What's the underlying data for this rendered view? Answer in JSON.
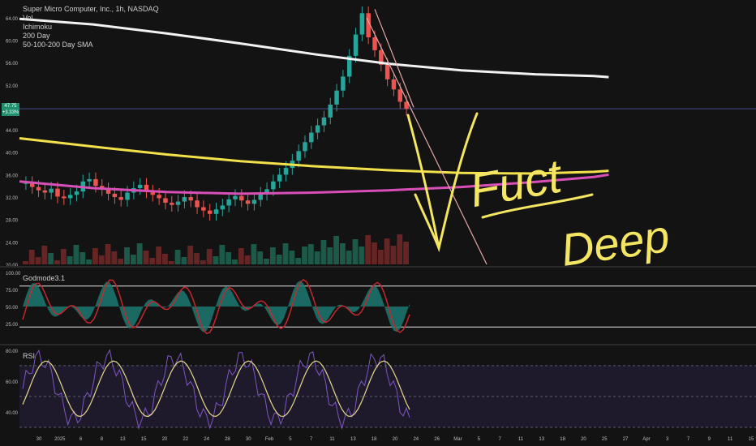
{
  "header": {
    "symbol_line": "Super Micro Computer, Inc., 1h, NASDAQ",
    "indicators": [
      "Vol",
      "Ichimoku",
      "200 Day",
      "50-100-200 Day SMA"
    ]
  },
  "price_badge": {
    "value": "47.75",
    "change": "+3.33%"
  },
  "chart_data": {
    "type": "candlestick",
    "price_axis": {
      "ticks": [
        "64.00",
        "60.00",
        "56.00",
        "52.00",
        "48.00",
        "44.00",
        "40.00",
        "36.00",
        "32.00",
        "28.00",
        "24.00",
        "20.00"
      ],
      "ylim": [
        20,
        66
      ]
    },
    "x_axis_ticks": [
      "30",
      "2025",
      "6",
      "8",
      "13",
      "15",
      "20",
      "22",
      "24",
      "28",
      "30",
      "Feb",
      "5",
      "7",
      "11",
      "13",
      "18",
      "20",
      "24",
      "26",
      "Mar",
      "5",
      "7",
      "11",
      "13",
      "18",
      "20",
      "25",
      "27",
      "Apr",
      "3",
      "7",
      "9",
      "11",
      "15"
    ],
    "current_price": 47.75,
    "series": [
      {
        "name": "200 Day",
        "color": "#f2f2f2",
        "points": [
          [
            0,
            63.8
          ],
          [
            0.1,
            62.8
          ],
          [
            0.2,
            61.2
          ],
          [
            0.3,
            59.4
          ],
          [
            0.4,
            57.5
          ],
          [
            0.5,
            55.8
          ],
          [
            0.6,
            54.6
          ],
          [
            0.7,
            53.9
          ],
          [
            0.78,
            53.6
          ],
          [
            0.8,
            53.4
          ]
        ]
      },
      {
        "name": "200 Day SMA",
        "color": "#f2e14a",
        "points": [
          [
            0,
            42.5
          ],
          [
            0.1,
            41.0
          ],
          [
            0.2,
            39.6
          ],
          [
            0.3,
            38.4
          ],
          [
            0.4,
            37.5
          ],
          [
            0.5,
            36.8
          ],
          [
            0.6,
            36.3
          ],
          [
            0.7,
            36.2
          ],
          [
            0.78,
            36.5
          ],
          [
            0.8,
            36.7
          ]
        ]
      },
      {
        "name": "100 Day SMA",
        "color": "#d94fb8",
        "points": [
          [
            0,
            34.8
          ],
          [
            0.1,
            33.6
          ],
          [
            0.2,
            32.9
          ],
          [
            0.3,
            32.6
          ],
          [
            0.4,
            32.8
          ],
          [
            0.5,
            33.2
          ],
          [
            0.6,
            33.8
          ],
          [
            0.7,
            34.7
          ],
          [
            0.78,
            35.6
          ],
          [
            0.8,
            36.0
          ]
        ]
      }
    ],
    "candles_close": [
      34.5,
      33.8,
      33.2,
      32.8,
      33.5,
      32.1,
      31.8,
      32.4,
      33.0,
      34.8,
      35.2,
      34.0,
      33.4,
      32.6,
      32.0,
      31.5,
      32.8,
      33.6,
      34.2,
      33.0,
      32.4,
      31.8,
      31.0,
      30.6,
      31.2,
      32.0,
      31.4,
      30.2,
      29.6,
      29.0,
      29.8,
      30.5,
      31.6,
      32.2,
      31.4,
      30.8,
      31.5,
      32.6,
      33.4,
      34.8,
      36.0,
      37.2,
      38.5,
      40.2,
      41.8,
      43.5,
      44.8,
      46.2,
      48.5,
      51.0,
      53.5,
      57.2,
      61.0,
      64.8,
      60.5,
      58.2,
      55.6,
      53.0,
      51.2,
      49.0,
      47.75
    ],
    "godmode": {
      "title": "Godmode3.1",
      "ticks": [
        "100.00",
        "75.00",
        "50.00",
        "25.00"
      ],
      "ylim": [
        0,
        100
      ],
      "levels": [
        80,
        20
      ]
    },
    "rsi": {
      "title": "RSI",
      "ticks": [
        "80.00",
        "60.00",
        "40.00"
      ],
      "ylim": [
        30,
        82
      ],
      "levels": [
        70,
        50,
        30
      ]
    }
  },
  "annotation": {
    "lines": [
      "Fuct",
      "Deep"
    ]
  }
}
